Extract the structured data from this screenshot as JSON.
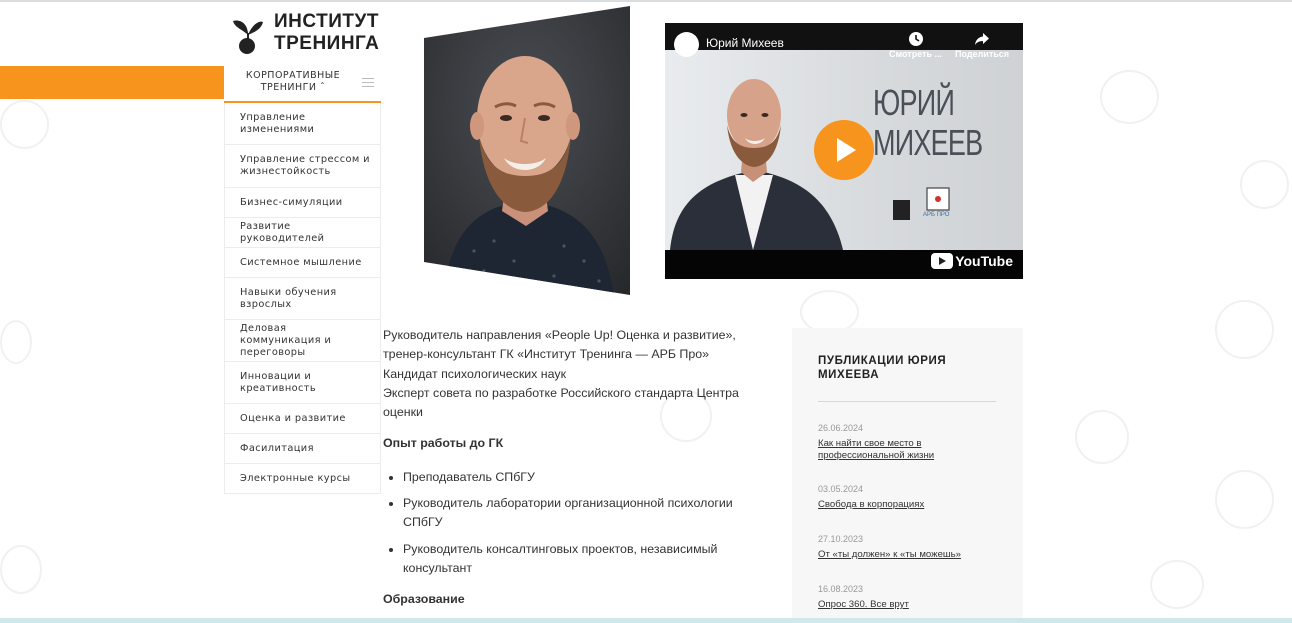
{
  "brand": {
    "line1": "ИНСТИТУТ",
    "line2": "ТРЕНИНГА",
    "accent": "#f7941d"
  },
  "sidebar": {
    "heading": "КОРПОРАТИВНЫЕ ТРЕНИНГИ ˆ",
    "items": [
      {
        "label": "Управление изменениями"
      },
      {
        "label": "Управление стрессом и жизнестойкость"
      },
      {
        "label": "Бизнес-симуляции"
      },
      {
        "label": "Развитие руководителей"
      },
      {
        "label": "Системное мышление"
      },
      {
        "label": "Навыки обучения взрослых"
      },
      {
        "label": "Деловая коммуникация и переговоры"
      },
      {
        "label": "Инновации и креативность"
      },
      {
        "label": "Оценка и развитие"
      },
      {
        "label": "Фасилитация"
      },
      {
        "label": "Электронные курсы"
      }
    ]
  },
  "video": {
    "title": "Юрий Михеев",
    "watch_later": "Смотреть ...",
    "share": "Поделиться",
    "overlay_name_1": "ЮРИЙ",
    "overlay_name_2": "МИХЕЕВ",
    "overlay_brand": "АРБ ПРО",
    "youtube": "YouTube"
  },
  "bio": {
    "lines": [
      "Руководитель направления «People Up! Оценка и развитие»,",
      "тренер-консультант ГК «Институт Тренинга — АРБ Про»",
      "Кандидат психологических наук",
      "Эксперт совета по разработке Российского стандарта Центра оценки"
    ],
    "experience_heading": "Опыт работы до ГК",
    "experience": [
      "Преподаватель СПбГУ",
      "Руководитель лаборатории организационной психологии СПбГУ",
      "Руководитель консалтинговых проектов, независимый консультант"
    ],
    "education_heading": "Образование"
  },
  "publications": {
    "title": "ПУБЛИКАЦИИ ЮРИЯ МИХЕЕВА",
    "items": [
      {
        "date": "26.06.2024",
        "title": "Как найти свое место в профессиональной жизни"
      },
      {
        "date": "03.05.2024",
        "title": "Свобода в корпорациях"
      },
      {
        "date": "27.10.2023",
        "title": "От «ты должен» к «ты можешь»"
      },
      {
        "date": "16.08.2023",
        "title": "Опрос 360. Все врут"
      }
    ]
  }
}
